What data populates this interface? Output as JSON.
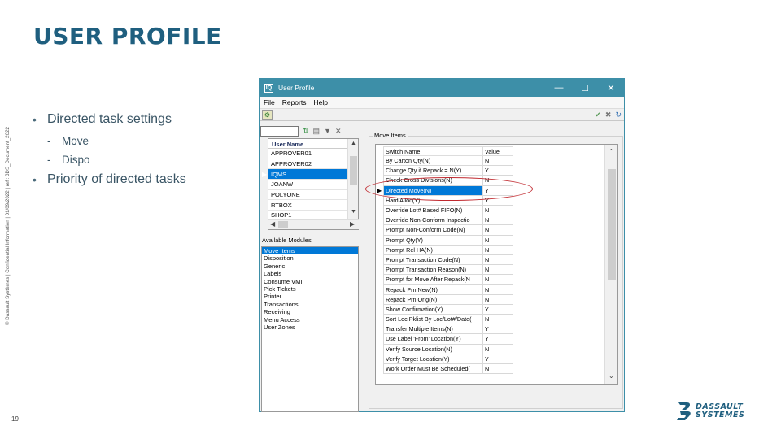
{
  "slide": {
    "title": "USER PROFILE",
    "copyright": "© Dassault Systèmes | Confidential Information | 01/09/2022 | ref.: 3DS_Document_2022",
    "page_number": "19",
    "bullets": [
      {
        "text": "Directed task settings",
        "sub": [
          "Move",
          "Dispo"
        ]
      },
      {
        "text": "Priority of directed tasks",
        "sub": []
      }
    ],
    "logo": {
      "line1": "DASSAULT",
      "line2": "SYSTEMES",
      "color": "#1f5f7f"
    },
    "highlight_color": "#c0282e"
  },
  "window": {
    "title": "User Profile",
    "icon": "app-icon",
    "controls": {
      "minimize": "—",
      "maximize": "☐",
      "close": "✕"
    },
    "menu": [
      "File",
      "Reports",
      "Help"
    ],
    "accent": "#3d8fa8"
  },
  "left_panel": {
    "user_list": {
      "header": "User Name",
      "rows": [
        "APPROVER01",
        "APPROVER02",
        "IQMS",
        "JOANW",
        "POLYONE",
        "RTBOX",
        "SHOP1"
      ],
      "selected": "IQMS"
    },
    "available_modules_label": "Available Modules",
    "modules": [
      "Move Items",
      "Disposition",
      "Generic",
      "Labels",
      "Consume VMI",
      "Pick Tickets",
      "Printer",
      "Transactions",
      "Receiving",
      "Menu Access",
      "User Zones"
    ],
    "selected_module": "Move Items"
  },
  "right_panel": {
    "group_label": "Move Items",
    "columns": [
      "Switch Name",
      "Value"
    ],
    "rows": [
      {
        "name": "By Carton Qty(N)",
        "value": "N"
      },
      {
        "name": "Change Qty if Repack = N(Y)",
        "value": "Y"
      },
      {
        "name": "Check Cross Divisions(N)",
        "value": "N"
      },
      {
        "name": "Directed Move(N)",
        "value": "Y"
      },
      {
        "name": "Hard Alloc(Y)",
        "value": "Y"
      },
      {
        "name": "Override Lot# Based FIFO(N)",
        "value": "N"
      },
      {
        "name": "Override Non-Conform Inspectio",
        "value": "N"
      },
      {
        "name": "Prompt Non-Conform Code(N)",
        "value": "N"
      },
      {
        "name": "Prompt Qty(Y)",
        "value": "N"
      },
      {
        "name": "Prompt Rel HA(N)",
        "value": "N"
      },
      {
        "name": "Prompt Transaction Code(N)",
        "value": "N"
      },
      {
        "name": "Prompt Transaction Reason(N)",
        "value": "N"
      },
      {
        "name": "Prompt for Move After Repack(N",
        "value": "N"
      },
      {
        "name": "Repack Prn New(N)",
        "value": "N"
      },
      {
        "name": "Repack Prn Orig(N)",
        "value": "N"
      },
      {
        "name": "Show Confirmation(Y)",
        "value": "Y"
      },
      {
        "name": "Sort Loc Pklist By Loc/Lot#/Date(",
        "value": "N"
      },
      {
        "name": "Transfer Multiple Items(N)",
        "value": "Y"
      },
      {
        "name": "Use Label 'From' Location(Y)",
        "value": "Y"
      },
      {
        "name": "Verify Source Location(N)",
        "value": "N"
      },
      {
        "name": "Verify Target Location(Y)",
        "value": "Y"
      },
      {
        "name": "Work Order Must Be Scheduled(",
        "value": "N"
      }
    ],
    "selected_row": "Directed Move(N)"
  }
}
